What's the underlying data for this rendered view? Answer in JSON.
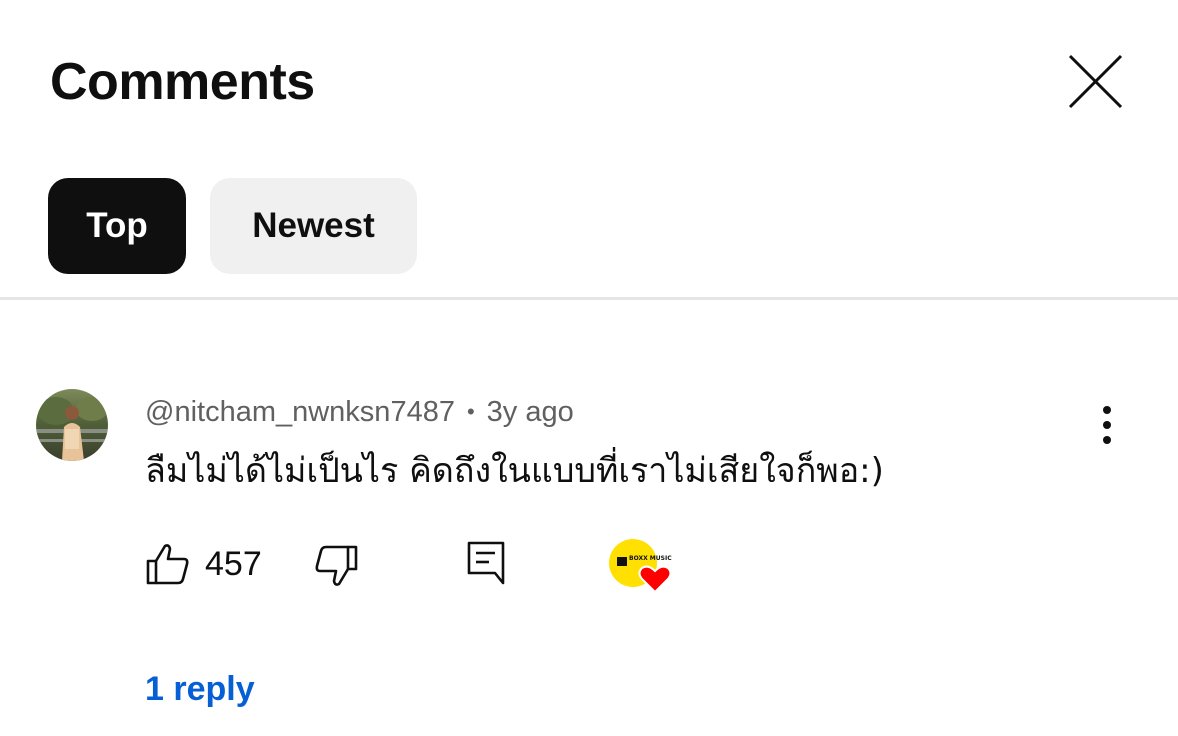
{
  "header": {
    "title": "Comments"
  },
  "filters": [
    {
      "label": "Top",
      "selected": true
    },
    {
      "label": "Newest",
      "selected": false
    }
  ],
  "comment": {
    "author": "@nitcham_nwnksn7487",
    "separator": "•",
    "time": "3y ago",
    "text": "ลืมไม่ได้ไม่เป็นไร คิดถึงในแบบที่เราไม่เสียใจก็พอ:)",
    "likes": "457",
    "replies_label": "1 reply",
    "creator_heart_badge": "BOXX MUSIC"
  },
  "colors": {
    "text_primary": "#0f0f0f",
    "text_secondary": "#606060",
    "link": "#065fd4",
    "chip_selected_bg": "#0f0f0f",
    "chip_bg": "#f0f0f0",
    "heart": "#ff0000",
    "badge_yellow": "#ffe000"
  },
  "icons": {
    "close": "close-icon",
    "more": "more-vert-icon",
    "like": "thumbs-up-icon",
    "dislike": "thumbs-down-icon",
    "reply": "comment-reply-icon",
    "heart": "creator-heart-icon"
  }
}
